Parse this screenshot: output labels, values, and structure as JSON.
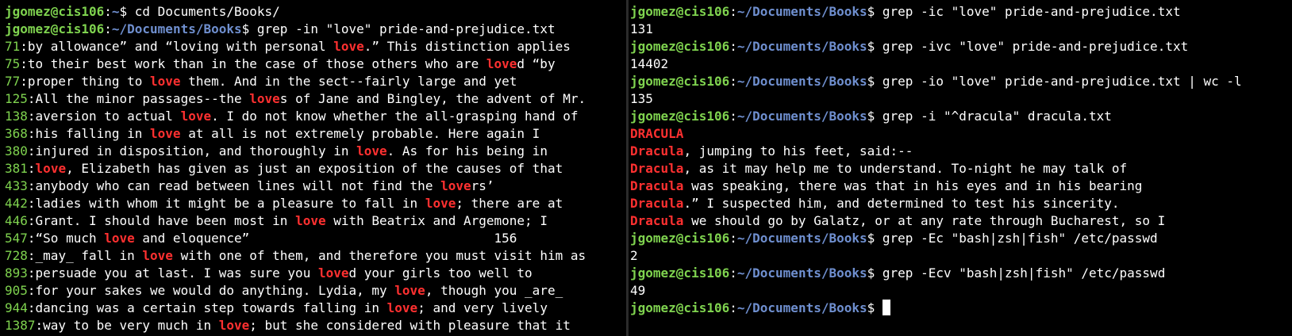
{
  "theme": {
    "background": "#000000",
    "text": "#ffffff",
    "prompt_user": "#7fd34f",
    "prompt_path": "#6f8fcf",
    "line_number": "#7fd34f",
    "match": "#ff3030"
  },
  "left_pane": {
    "lines": [
      {
        "type": "prompt",
        "user": "jgomez@cis106",
        "sep": ":",
        "path": "~",
        "sym": "$ ",
        "cmd": "cd Documents/Books/"
      },
      {
        "type": "prompt",
        "user": "jgomez@cis106",
        "sep": ":",
        "path": "~/Documents/Books",
        "sym": "$ ",
        "cmd": "grep -in \"love\" pride-and-prejudice.txt"
      },
      {
        "type": "output",
        "segments": [
          {
            "t": "71",
            "c": "lnum"
          },
          {
            "t": ":by allowance” and “loving with personal "
          },
          {
            "t": "love",
            "c": "match"
          },
          {
            "t": ".” This distinction applies"
          }
        ]
      },
      {
        "type": "output",
        "segments": [
          {
            "t": "75",
            "c": "lnum"
          },
          {
            "t": ":to their best work than in the case of those others who are "
          },
          {
            "t": "love",
            "c": "match"
          },
          {
            "t": "d “by"
          }
        ]
      },
      {
        "type": "output",
        "segments": [
          {
            "t": "77",
            "c": "lnum"
          },
          {
            "t": ":proper thing to "
          },
          {
            "t": "love",
            "c": "match"
          },
          {
            "t": " them. And in the sect--fairly large and yet"
          }
        ]
      },
      {
        "type": "output",
        "segments": [
          {
            "t": "125",
            "c": "lnum"
          },
          {
            "t": ":All the minor passages--the "
          },
          {
            "t": "love",
            "c": "match"
          },
          {
            "t": "s of Jane and Bingley, the advent of Mr."
          }
        ]
      },
      {
        "type": "output",
        "segments": [
          {
            "t": "138",
            "c": "lnum"
          },
          {
            "t": ":aversion to actual "
          },
          {
            "t": "love",
            "c": "match"
          },
          {
            "t": ". I do not know whether the all-grasping hand of"
          }
        ]
      },
      {
        "type": "output",
        "segments": [
          {
            "t": "368",
            "c": "lnum"
          },
          {
            "t": ":his falling in "
          },
          {
            "t": "love",
            "c": "match"
          },
          {
            "t": " at all is not extremely probable. Here again I"
          }
        ]
      },
      {
        "type": "output",
        "segments": [
          {
            "t": "380",
            "c": "lnum"
          },
          {
            "t": ":injured in disposition, and thoroughly in "
          },
          {
            "t": "love",
            "c": "match"
          },
          {
            "t": ". As for his being in"
          }
        ]
      },
      {
        "type": "output",
        "segments": [
          {
            "t": "381",
            "c": "lnum"
          },
          {
            "t": ":"
          },
          {
            "t": "love",
            "c": "match"
          },
          {
            "t": ", Elizabeth has given as just an exposition of the causes of that"
          }
        ]
      },
      {
        "type": "output",
        "segments": [
          {
            "t": "433",
            "c": "lnum"
          },
          {
            "t": ":anybody who can read between lines will not find the "
          },
          {
            "t": "love",
            "c": "match"
          },
          {
            "t": "rs’"
          }
        ]
      },
      {
        "type": "output",
        "segments": [
          {
            "t": "442",
            "c": "lnum"
          },
          {
            "t": ":ladies with whom it might be a pleasure to fall in "
          },
          {
            "t": "love",
            "c": "match"
          },
          {
            "t": "; there are at"
          }
        ]
      },
      {
        "type": "output",
        "segments": [
          {
            "t": "446",
            "c": "lnum"
          },
          {
            "t": ":Grant. I should have been most in "
          },
          {
            "t": "love",
            "c": "match"
          },
          {
            "t": " with Beatrix and Argemone; I"
          }
        ]
      },
      {
        "type": "output",
        "segments": [
          {
            "t": "547",
            "c": "lnum"
          },
          {
            "t": ":“So much "
          },
          {
            "t": "love",
            "c": "match"
          },
          {
            "t": " and eloquence”                                156"
          }
        ]
      },
      {
        "type": "output",
        "segments": [
          {
            "t": "728",
            "c": "lnum"
          },
          {
            "t": ":_may_ fall in "
          },
          {
            "t": "love",
            "c": "match"
          },
          {
            "t": " with one of them, and therefore you must visit him as"
          }
        ]
      },
      {
        "type": "output",
        "segments": [
          {
            "t": "893",
            "c": "lnum"
          },
          {
            "t": ":persuade you at last. I was sure you "
          },
          {
            "t": "love",
            "c": "match"
          },
          {
            "t": "d your girls too well to"
          }
        ]
      },
      {
        "type": "output",
        "segments": [
          {
            "t": "905",
            "c": "lnum"
          },
          {
            "t": ":for your sakes we would do anything. Lydia, my "
          },
          {
            "t": "love",
            "c": "match"
          },
          {
            "t": ", though you _are_"
          }
        ]
      },
      {
        "type": "output",
        "segments": [
          {
            "t": "944",
            "c": "lnum"
          },
          {
            "t": ":dancing was a certain step towards falling in "
          },
          {
            "t": "love",
            "c": "match"
          },
          {
            "t": "; and very lively"
          }
        ]
      },
      {
        "type": "output",
        "segments": [
          {
            "t": "1387",
            "c": "lnum"
          },
          {
            "t": ":way to be very much in "
          },
          {
            "t": "love",
            "c": "match"
          },
          {
            "t": "; but she considered with pleasure that it"
          }
        ]
      }
    ]
  },
  "right_pane": {
    "lines": [
      {
        "type": "prompt",
        "user": "jgomez@cis106",
        "sep": ":",
        "path": "~/Documents/Books",
        "sym": "$ ",
        "cmd": "grep -ic \"love\" pride-and-prejudice.txt"
      },
      {
        "type": "output",
        "segments": [
          {
            "t": "131"
          }
        ]
      },
      {
        "type": "prompt",
        "user": "jgomez@cis106",
        "sep": ":",
        "path": "~/Documents/Books",
        "sym": "$ ",
        "cmd": "grep -ivc \"love\" pride-and-prejudice.txt"
      },
      {
        "type": "output",
        "segments": [
          {
            "t": "14402"
          }
        ]
      },
      {
        "type": "prompt",
        "user": "jgomez@cis106",
        "sep": ":",
        "path": "~/Documents/Books",
        "sym": "$ ",
        "cmd": "grep -io \"love\" pride-and-prejudice.txt | wc -l"
      },
      {
        "type": "output",
        "segments": [
          {
            "t": "135"
          }
        ]
      },
      {
        "type": "prompt",
        "user": "jgomez@cis106",
        "sep": ":",
        "path": "~/Documents/Books",
        "sym": "$ ",
        "cmd": "grep -i \"^dracula\" dracula.txt"
      },
      {
        "type": "output",
        "segments": [
          {
            "t": "DRACULA",
            "c": "match"
          }
        ]
      },
      {
        "type": "output",
        "segments": [
          {
            "t": "Dracula",
            "c": "match"
          },
          {
            "t": ", jumping to his feet, said:--"
          }
        ]
      },
      {
        "type": "output",
        "segments": [
          {
            "t": "Dracula",
            "c": "match"
          },
          {
            "t": ", as it may help me to understand. To-night he may talk of"
          }
        ]
      },
      {
        "type": "output",
        "segments": [
          {
            "t": "Dracula",
            "c": "match"
          },
          {
            "t": " was speaking, there was that in his eyes and in his bearing"
          }
        ]
      },
      {
        "type": "output",
        "segments": [
          {
            "t": "Dracula",
            "c": "match"
          },
          {
            "t": ".” I suspected him, and determined to test his sincerity."
          }
        ]
      },
      {
        "type": "output",
        "segments": [
          {
            "t": "Dracula",
            "c": "match"
          },
          {
            "t": " we should go by Galatz, or at any rate through Bucharest, so I"
          }
        ]
      },
      {
        "type": "prompt",
        "user": "jgomez@cis106",
        "sep": ":",
        "path": "~/Documents/Books",
        "sym": "$ ",
        "cmd": "grep -Ec \"bash|zsh|fish\" /etc/passwd"
      },
      {
        "type": "output",
        "segments": [
          {
            "t": "2"
          }
        ]
      },
      {
        "type": "prompt",
        "user": "jgomez@cis106",
        "sep": ":",
        "path": "~/Documents/Books",
        "sym": "$ ",
        "cmd": "grep -Ecv \"bash|zsh|fish\" /etc/passwd"
      },
      {
        "type": "output",
        "segments": [
          {
            "t": "49"
          }
        ]
      },
      {
        "type": "prompt",
        "user": "jgomez@cis106",
        "sep": ":",
        "path": "~/Documents/Books",
        "sym": "$ ",
        "cmd": "",
        "cursor": true
      }
    ]
  }
}
